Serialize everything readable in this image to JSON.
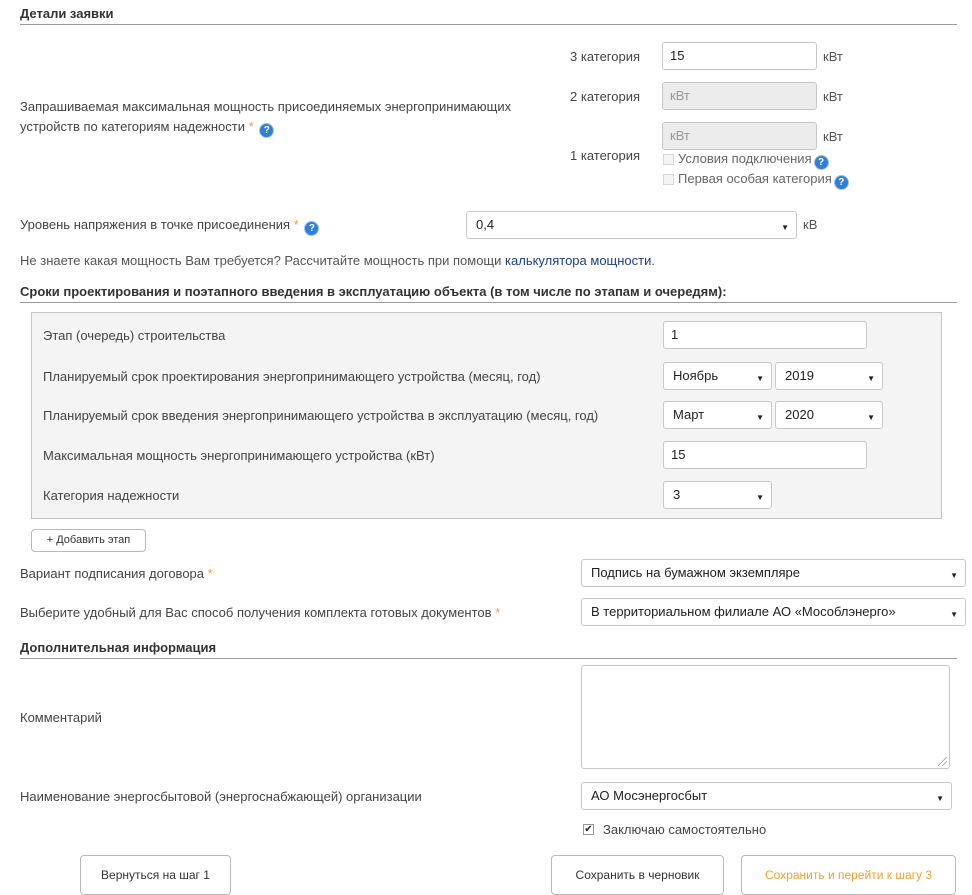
{
  "sections": {
    "details": "Детали заявки",
    "terms": "Сроки проектирования и поэтапного введения в эксплуатацию объекта (в том числе по этапам и очередям):",
    "additional": "Дополнительная информация"
  },
  "power": {
    "label": "Запрашиваемая максимальная мощность присоединяемых энергопринимающих устройств по категориям надежности",
    "required_mark": "*",
    "cat3_label": "3 категория",
    "cat3_value": "15",
    "cat2_label": "2 категория",
    "cat2_placeholder": "кВт",
    "cat1_label": "1 категория",
    "cat1_placeholder": "кВт",
    "unit": "кВт",
    "conditions_label": "Условия подключения",
    "first_special_label": "Первая особая категория"
  },
  "voltage": {
    "label": "Уровень напряжения в точке присоединения",
    "required_mark": "*",
    "value": "0,4",
    "unit": "кВ"
  },
  "calc_hint": {
    "prefix": "Не знаете какая мощность Вам требуется? Рассчитайте мощность при помощи",
    "link": "калькулятора мощности",
    "suffix": "."
  },
  "stage": {
    "stage_label": "Этап (очередь) строительства",
    "stage_value": "1",
    "design_label": "Планируемый срок проектирования энергопринимающего устройства (месяц, год)",
    "design_month": "Ноябрь",
    "design_year": "2019",
    "commission_label": "Планируемый срок введения энергопринимающего устройства в эксплуатацию (месяц, год)",
    "commission_month": "Март",
    "commission_year": "2020",
    "maxpower_label": "Максимальная мощность энергопринимающего устройства (кВт)",
    "maxpower_value": "15",
    "reliability_label": "Категория надежности",
    "reliability_value": "3"
  },
  "add_stage_button": "+ Добавить этап",
  "contract": {
    "label": "Вариант подписания договора",
    "required_mark": "*",
    "value": "Подпись на бумажном экземпляре"
  },
  "delivery": {
    "label": "Выберите удобный для Вас способ получения комплекта готовых документов",
    "required_mark": "*",
    "value": "В территориальном филиале АО «Мособлэнерго»"
  },
  "comment": {
    "label": "Комментарий",
    "value": ""
  },
  "supplier": {
    "label": "Наименование энергосбытовой (энергоснабжающей) организации",
    "value": "АО Мосэнергосбыт",
    "self_label": "Заключаю самостоятельно",
    "self_checked": true
  },
  "buttons": {
    "back": "Вернуться на шаг 1",
    "draft": "Сохранить в черновик",
    "next": "Сохранить и перейти к шагу 3"
  },
  "colors": {
    "accent": "#f0a030",
    "link": "#1d3f8a",
    "help": "#2f7fd6"
  }
}
